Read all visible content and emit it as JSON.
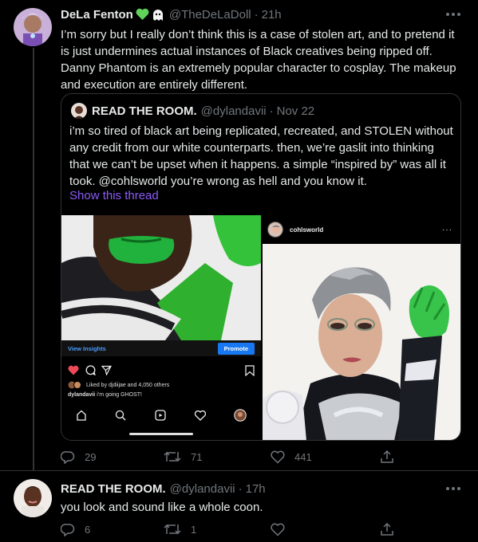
{
  "tweet1": {
    "name": "DeLa Fenton",
    "emojis": [
      "green-heart-emoji",
      "ghost-emoji"
    ],
    "handle": "@TheDeLaDoll",
    "sep": "·",
    "time": "21h",
    "text": "I’m sorry but I really don’t think this is a case of stolen art, and to pretend it is just undermines actual instances of Black creatives being ripped off. Danny Phantom is an extremely popular character to cosplay. The makeup and execution are entirely different.",
    "quote": {
      "name": "READ THE ROOM.",
      "handle": "@dylandavii",
      "sep": "·",
      "time": "Nov 22",
      "text": "i’m so tired of black art being replicated, recreated, and STOLEN without any credit from our white counterparts. then, we’re gaslit into thinking that we can’t be upset when it happens. a simple “inspired by” was all it took. @cohlsworld you’re wrong as hell and you know it.",
      "show_thread": "Show this thread",
      "left_image": {
        "view_insights": "View Insights",
        "promote": "Promote",
        "liked_by": "Liked by djdiijae and 4,050 others",
        "caption_user": "dylandavii",
        "caption_text": "i’m going GHOST!"
      },
      "right_image": {
        "username": "cohlsworld",
        "more": "···"
      }
    },
    "actions": {
      "replies": "29",
      "retweets": "71",
      "likes": "441"
    }
  },
  "tweet2": {
    "name": "READ THE ROOM.",
    "handle": "@dylandavii",
    "sep": "·",
    "time": "17h",
    "text": "you look and sound like a whole coon.",
    "actions": {
      "replies": "6",
      "retweets": "1",
      "likes": ""
    }
  },
  "colors": {
    "background": "#000000",
    "link_purple": "#8b5cf6",
    "muted": "#71767b",
    "text": "#e7e9ea"
  }
}
